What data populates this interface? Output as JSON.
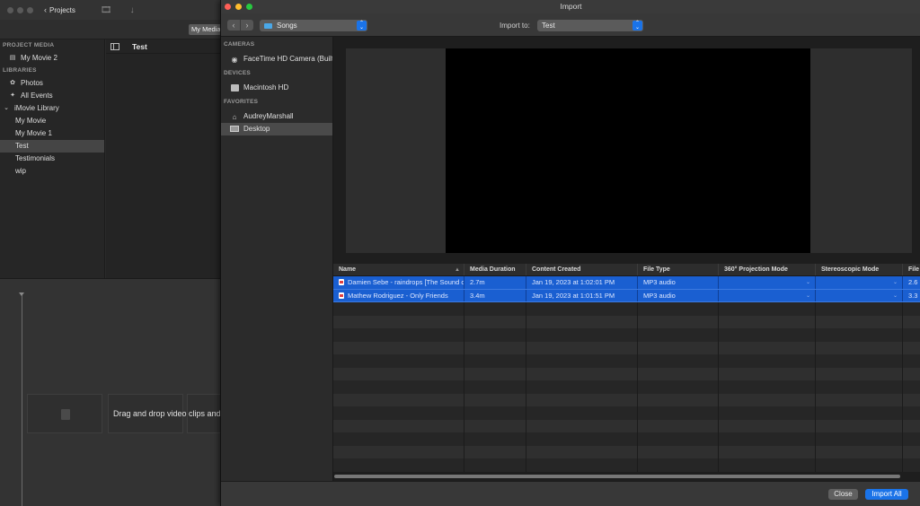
{
  "imovie": {
    "projects_label": "Projects",
    "my_media_label": "My Media",
    "sidebar": {
      "project_media_header": "PROJECT MEDIA",
      "project_item": "My Movie 2",
      "libraries_header": "LIBRARIES",
      "photos": "Photos",
      "all_events": "All Events",
      "library_name": "iMovie Library",
      "events": [
        "My Movie",
        "My Movie 1",
        "Test",
        "Testimonials",
        "wip"
      ],
      "selected_event": "Test"
    },
    "browser_title": "Test",
    "drop_text": "Drag and drop video clips and photos"
  },
  "import_window": {
    "title": "Import",
    "source_select": "Songs",
    "import_to_label": "Import to:",
    "import_to_value": "Test",
    "sidebar": {
      "cameras_header": "CAMERAS",
      "camera_item": "FaceTime HD Camera (Built-in)",
      "devices_header": "DEVICES",
      "device_item": "Macintosh HD",
      "favorites_header": "FAVORITES",
      "favorites": [
        "AudreyMarshall",
        "Desktop"
      ],
      "selected": "Desktop"
    },
    "table": {
      "columns": [
        "Name",
        "Media Duration",
        "Content Created",
        "File Type",
        "360° Projection Mode",
        "Stereoscopic Mode",
        "File Size"
      ],
      "rows": [
        {
          "name": "Damien Sebe - raindrops [The Sound of Rain]",
          "duration": "2.7m",
          "created": "Jan 19, 2023 at 1:02:01 PM",
          "type": "MP3 audio",
          "projection": "",
          "stereo": "",
          "size": "2.6"
        },
        {
          "name": "Mathew Rodriguez - Only Friends",
          "duration": "3.4m",
          "created": "Jan 19, 2023 at 1:01:51 PM",
          "type": "MP3 audio",
          "projection": "",
          "stereo": "",
          "size": "3.3"
        }
      ]
    },
    "buttons": {
      "close": "Close",
      "import_all": "Import All"
    },
    "colors": {
      "accent": "#1a73e8",
      "selection": "#1a5fd1",
      "close_light": "#ff5f57",
      "minimize_light": "#febc2e",
      "zoom_light": "#28c840"
    }
  }
}
